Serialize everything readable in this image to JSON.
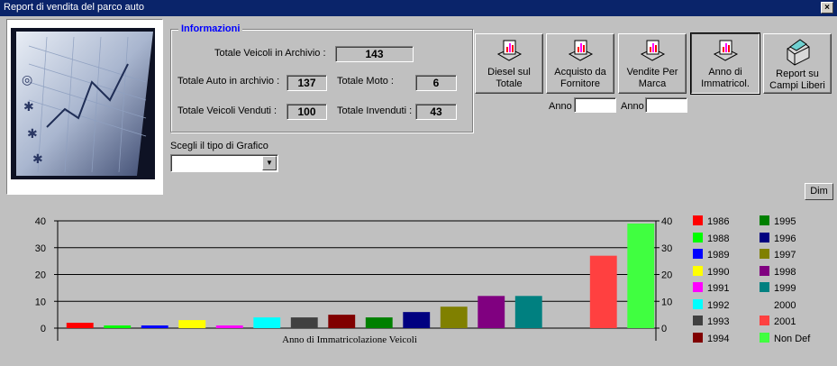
{
  "window": {
    "title": "Report di vendita del parco auto",
    "close_glyph": "×"
  },
  "info": {
    "group_label": "Informazioni",
    "totale_veicoli_label": "Totale Veicoli in Archivio :",
    "totale_veicoli_value": "143",
    "totale_auto_label": "Totale Auto in archivio  :",
    "totale_auto_value": "137",
    "totale_moto_label": "Totale Moto :",
    "totale_moto_value": "6",
    "venduti_label": "Totale Veicoli Venduti :",
    "venduti_value": "100",
    "invenduti_label": "Totale Invenduti :",
    "invenduti_value": "43"
  },
  "toolbar": {
    "buttons": [
      {
        "label": "Diesel sul\nTotale",
        "icon": "report-icon"
      },
      {
        "label": "Acquisto da\nFornitore",
        "icon": "report-icon"
      },
      {
        "label": "Vendite Per\nMarca",
        "icon": "report-icon"
      },
      {
        "label": "Anno di\nImmatricol.",
        "icon": "report-icon",
        "active": true
      },
      {
        "label": "Report su\nCampi Liberi",
        "icon": "printer-icon"
      }
    ],
    "anno_label": "Anno",
    "anno_acquisto_value": "",
    "anno_vendite_value": ""
  },
  "grafico": {
    "label": "Scegli il tipo di Grafico",
    "selected": ""
  },
  "dim_label": "Dim",
  "chart_data": {
    "type": "bar",
    "xlabel": "Anno di Immatricolazione Veicoli",
    "ylabel": "",
    "ylim": [
      0,
      40
    ],
    "yticks": [
      0,
      10,
      20,
      30,
      40
    ],
    "grid": true,
    "legend_position": "right",
    "categories": [
      "1986",
      "1988",
      "1989",
      "1990",
      "1991",
      "1992",
      "1993",
      "1994",
      "1995",
      "1996",
      "1997",
      "1998",
      "1999",
      "2000",
      "2001",
      "Non Def"
    ],
    "values": [
      2,
      1,
      1,
      3,
      1,
      4,
      4,
      5,
      4,
      6,
      8,
      12,
      12,
      0,
      27,
      39
    ],
    "colors": [
      "#ff0000",
      "#00ff00",
      "#0000ff",
      "#ffff00",
      "#ff00ff",
      "#00ffff",
      "#404040",
      "#800000",
      "#008000",
      "#000080",
      "#808000",
      "#800080",
      "#008080",
      "#c0c0c0",
      "#ff4040",
      "#40ff40"
    ]
  }
}
